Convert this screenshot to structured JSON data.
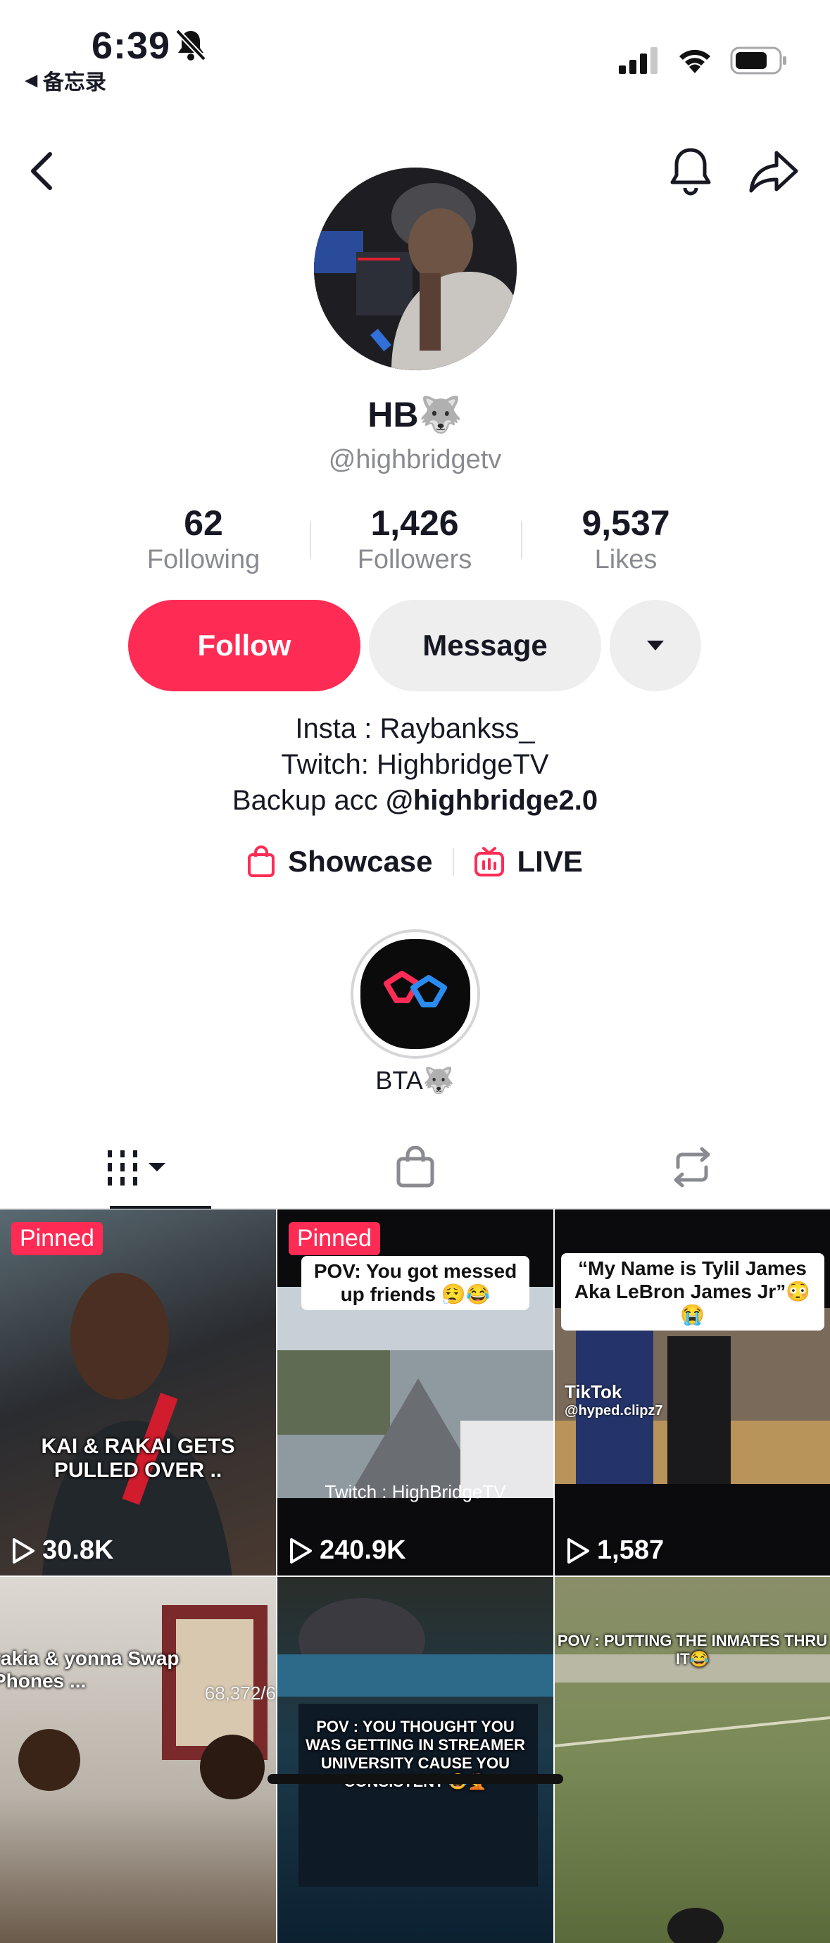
{
  "status_bar": {
    "time": "6:39",
    "back_label": "备忘录"
  },
  "profile": {
    "name": "HB🐺",
    "handle": "@highbridgetv",
    "stats": [
      {
        "value": "62",
        "label": "Following"
      },
      {
        "value": "1,426",
        "label": "Followers"
      },
      {
        "value": "9,537",
        "label": "Likes"
      }
    ]
  },
  "actions": {
    "follow": "Follow",
    "message": "Message"
  },
  "bio": {
    "line1": "Insta : Raybankss_",
    "line2": "Twitch: HighbridgeTV",
    "line3_prefix": "Backup acc ",
    "line3_link": "@highbridge2.0"
  },
  "links": {
    "showcase": "Showcase",
    "live": "LIVE"
  },
  "highlight": {
    "label": "BTA🐺"
  },
  "colors": {
    "accent": "#fe2c55",
    "secondary_button": "#eeeeef",
    "muted_text": "#8a8b91"
  },
  "videos": [
    {
      "pinned": "Pinned",
      "caption": "KAI & RAKAI GETS PULLED OVER ..",
      "views": "30.8K"
    },
    {
      "pinned": "Pinned",
      "caption": "POV: You got messed up friends 😮‍💨😂",
      "subcaption": "Twitch : HighBridgeTV",
      "views": "240.9K"
    },
    {
      "caption": "“My Name is Tylil James Aka LeBron James Jr”😳😭",
      "watermark": "TikTok",
      "watermark_handle": "@hyped.clipz7",
      "views": "1,587"
    },
    {
      "caption": "rakia & yonna Swap Phones ...",
      "overlay_number": "68,372/6"
    },
    {
      "caption": "POV : YOU THOUGHT YOU WAS GETTING IN STREAMER UNIVERSITY CAUSE YOU CONSISTENT 😂🤦"
    },
    {
      "caption": "POV : PUTTING THE INMATES THRU IT😂"
    }
  ]
}
